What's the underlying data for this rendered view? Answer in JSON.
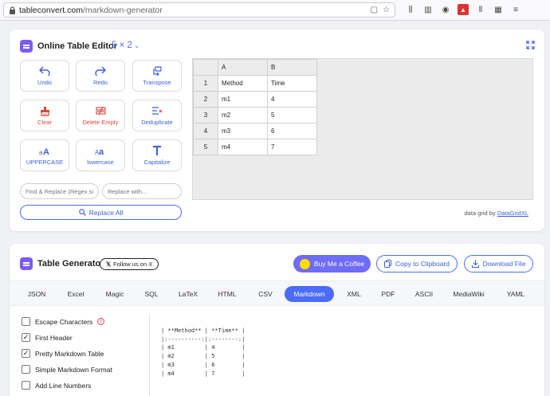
{
  "browser": {
    "url_host": "tableconvert.com",
    "url_path": "/markdown-generator"
  },
  "editor": {
    "title": "Online Table Editor",
    "size": "5 × 2",
    "tools": [
      {
        "label": "Undo",
        "icon": "undo-icon"
      },
      {
        "label": "Redo",
        "icon": "redo-icon"
      },
      {
        "label": "Transpose",
        "icon": "transpose-icon"
      },
      {
        "label": "Clear",
        "icon": "clear-icon"
      },
      {
        "label": "Delete Empty",
        "icon": "delete-empty-icon"
      },
      {
        "label": "Deduplicate",
        "icon": "deduplicate-icon"
      },
      {
        "label": "UPPERCASE",
        "icon": "uppercase-icon"
      },
      {
        "label": "lowercase",
        "icon": "lowercase-icon"
      },
      {
        "label": "Capitalize",
        "icon": "capitalize-icon"
      }
    ],
    "find_placeholder": "Find & Replace (Regex supported)",
    "replace_placeholder": "Replace with...",
    "replace_all": "Replace All",
    "grid": {
      "col_headers": [
        "A",
        "B"
      ],
      "rows": [
        {
          "num": "1",
          "cells": [
            "Method",
            "Time"
          ]
        },
        {
          "num": "2",
          "cells": [
            "m1",
            "4"
          ]
        },
        {
          "num": "3",
          "cells": [
            "m2",
            "5"
          ]
        },
        {
          "num": "4",
          "cells": [
            "m3",
            "6"
          ]
        },
        {
          "num": "5",
          "cells": [
            "m4",
            "7"
          ]
        }
      ]
    },
    "credit_prefix": "data grid by",
    "credit_link": "DataGridXL"
  },
  "generator": {
    "title": "Table Generator",
    "follow": "Follow us on X",
    "coffee": "Buy Me a Coffee",
    "copy": "Copy to Clipboard",
    "download": "Download File",
    "tabs": [
      "JSON",
      "Excel",
      "Magic",
      "SQL",
      "LaTeX",
      "HTML",
      "CSV",
      "Markdown",
      "XML",
      "PDF",
      "ASCII",
      "MediaWiki",
      "YAML"
    ],
    "active_tab": "Markdown",
    "options": [
      {
        "label": "Escape Characters",
        "checked": false,
        "info": true
      },
      {
        "label": "First Header",
        "checked": true
      },
      {
        "label": "Pretty Markdown Table",
        "checked": true
      },
      {
        "label": "Simple Markdown Format",
        "checked": false
      },
      {
        "label": "Add Line Numbers",
        "checked": false
      }
    ],
    "output": "| **Method** | **Time** |\n|:----------:|:--------:|\n| m1         | 4        |\n| m2         | 5        |\n| m3         | 6        |\n| m4         | 7        |"
  },
  "colors": {
    "accent": "#4a6cf7",
    "purple": "#7c5cf0",
    "coffee": "#6f6cf6"
  }
}
